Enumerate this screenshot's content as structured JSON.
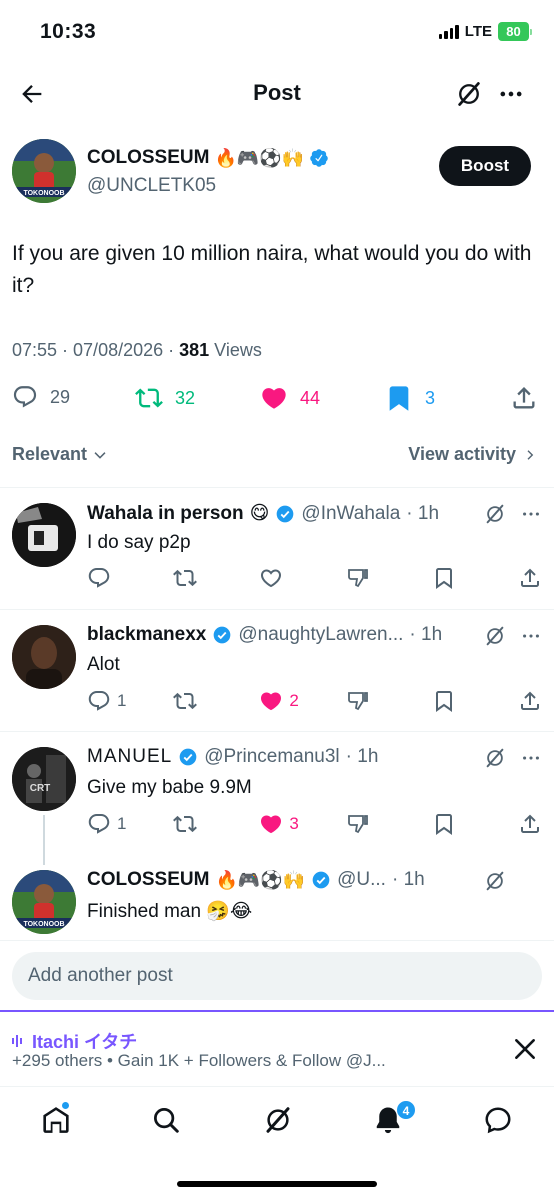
{
  "status_bar": {
    "time": "10:33",
    "network": "LTE",
    "battery": "80"
  },
  "header": {
    "title": "Post"
  },
  "post": {
    "author_name": "COLOSSEUM",
    "author_emoji": "🔥🎮⚽🙌",
    "author_handle": "@UNCLETK05",
    "avatar_label": "TOKONOOB",
    "boost_label": "Boost",
    "text": "If you are given 10 million naira, what would you do with it?",
    "timestamp": "07:55 · 07/08/2026 · ",
    "views_count": "381",
    "views_label": " Views",
    "stats": {
      "replies": "29",
      "reposts": "32",
      "likes": "44",
      "bookmarks": "3"
    }
  },
  "filters": {
    "sort_label": "Relevant",
    "activity_label": "View activity"
  },
  "replies": [
    {
      "name": "Wahala in person",
      "emoji": "😋",
      "handle": "@InWahala",
      "time": "· 1h",
      "text": "I do say p2p",
      "reply_count": "",
      "like_count": "",
      "liked": false
    },
    {
      "name": "blackmanexx",
      "emoji": "",
      "handle": "@naughtyLawren...",
      "time": "· 1h",
      "text": "Alot",
      "reply_count": "1",
      "like_count": "2",
      "liked": true
    },
    {
      "name": "MANUEL",
      "emoji": "",
      "handle": "@Princemanu3l",
      "time": "· 1h",
      "text": "Give my babe 9.9M",
      "reply_count": "1",
      "like_count": "3",
      "liked": true
    },
    {
      "name": "COLOSSEUM",
      "emoji": "🔥🎮⚽🙌",
      "handle": "@U...",
      "time": "· 1h",
      "text": "Finished man 🤧😂",
      "reply_count": "",
      "like_count": "",
      "liked": false
    }
  ],
  "composer": {
    "placeholder": "Add another post"
  },
  "spaces": {
    "title": "Itachi イタチ",
    "subtitle": "+295 others • Gain 1K + Followers & Follow @J..."
  },
  "tabbar": {
    "notifications_badge": "4"
  },
  "colors": {
    "accent": "#1d9bf0",
    "like": "#f91880",
    "repost": "#00ba7c",
    "spaces": "#7856ff"
  },
  "icons": [
    "back-arrow-icon",
    "grok-icon",
    "more-icon",
    "verified-icon",
    "reply-icon",
    "repost-icon",
    "heart-icon",
    "bookmark-icon",
    "share-icon",
    "chevron-down-icon",
    "chevron-right-icon",
    "dislike-icon",
    "close-icon",
    "home-icon",
    "search-icon",
    "bell-icon",
    "messages-icon"
  ]
}
